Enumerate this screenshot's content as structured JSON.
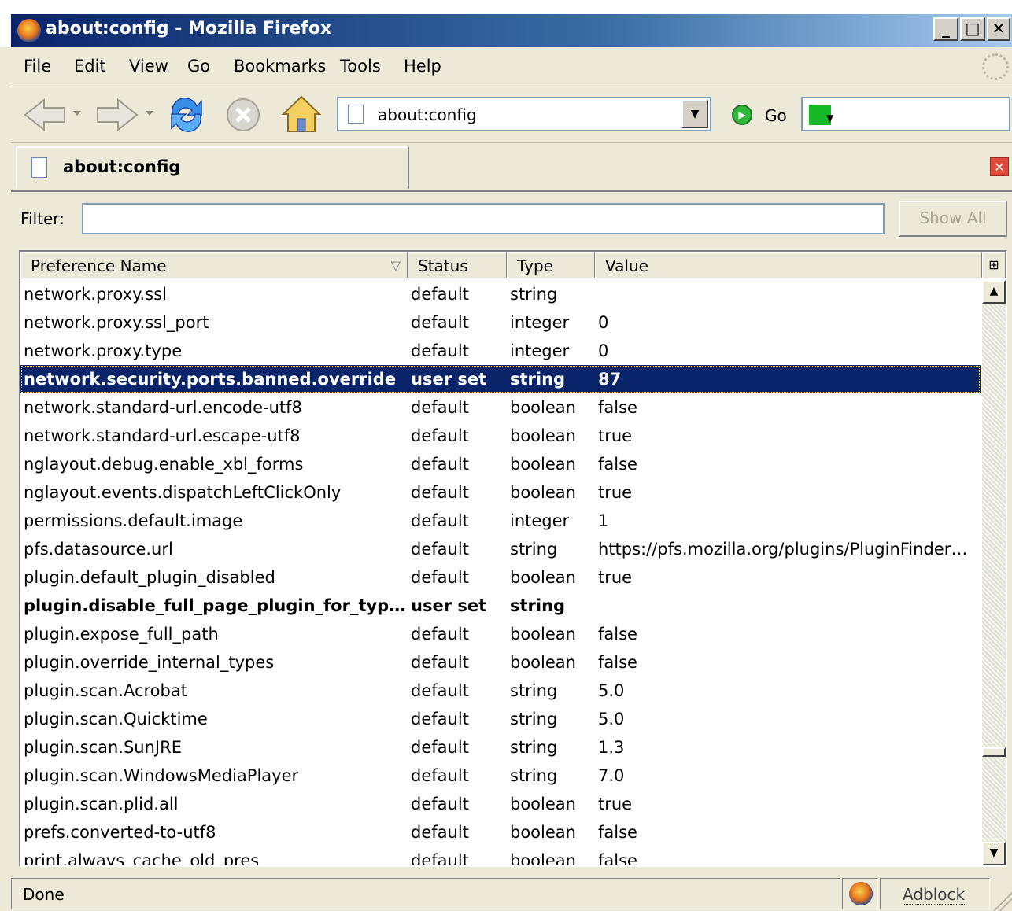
{
  "window": {
    "title": "about:config - Mozilla Firefox",
    "caption_buttons": {
      "minimize": "_",
      "maximize": "□",
      "close": "✕"
    }
  },
  "menu": [
    "File",
    "Edit",
    "View",
    "Go",
    "Bookmarks",
    "Tools",
    "Help"
  ],
  "navigation": {
    "url": "about:config",
    "go_label": "Go",
    "icons": [
      "back-icon",
      "forward-icon",
      "reload-icon",
      "stop-icon",
      "home-icon"
    ]
  },
  "tab": {
    "label": "about:config"
  },
  "filter": {
    "label": "Filter:",
    "value": "",
    "show_all_label": "Show All"
  },
  "columns": {
    "name": "Preference Name",
    "status": "Status",
    "type": "Type",
    "value": "Value"
  },
  "rows": [
    {
      "name": "network.proxy.ssl",
      "status": "default",
      "type": "string",
      "value": ""
    },
    {
      "name": "network.proxy.ssl_port",
      "status": "default",
      "type": "integer",
      "value": "0"
    },
    {
      "name": "network.proxy.type",
      "status": "default",
      "type": "integer",
      "value": "0"
    },
    {
      "name": "network.security.ports.banned.override",
      "status": "user set",
      "type": "string",
      "value": "87",
      "selected": true
    },
    {
      "name": "network.standard-url.encode-utf8",
      "status": "default",
      "type": "boolean",
      "value": "false"
    },
    {
      "name": "network.standard-url.escape-utf8",
      "status": "default",
      "type": "boolean",
      "value": "true"
    },
    {
      "name": "nglayout.debug.enable_xbl_forms",
      "status": "default",
      "type": "boolean",
      "value": "false"
    },
    {
      "name": "nglayout.events.dispatchLeftClickOnly",
      "status": "default",
      "type": "boolean",
      "value": "true"
    },
    {
      "name": "permissions.default.image",
      "status": "default",
      "type": "integer",
      "value": "1"
    },
    {
      "name": "pfs.datasource.url",
      "status": "default",
      "type": "string",
      "value": "https://pfs.mozilla.org/plugins/PluginFinderSer..."
    },
    {
      "name": "plugin.default_plugin_disabled",
      "status": "default",
      "type": "boolean",
      "value": "true"
    },
    {
      "name": "plugin.disable_full_page_plugin_for_types",
      "status": "user set",
      "type": "string",
      "value": ""
    },
    {
      "name": "plugin.expose_full_path",
      "status": "default",
      "type": "boolean",
      "value": "false"
    },
    {
      "name": "plugin.override_internal_types",
      "status": "default",
      "type": "boolean",
      "value": "false"
    },
    {
      "name": "plugin.scan.Acrobat",
      "status": "default",
      "type": "string",
      "value": "5.0"
    },
    {
      "name": "plugin.scan.Quicktime",
      "status": "default",
      "type": "string",
      "value": "5.0"
    },
    {
      "name": "plugin.scan.SunJRE",
      "status": "default",
      "type": "string",
      "value": "1.3"
    },
    {
      "name": "plugin.scan.WindowsMediaPlayer",
      "status": "default",
      "type": "string",
      "value": "7.0"
    },
    {
      "name": "plugin.scan.plid.all",
      "status": "default",
      "type": "boolean",
      "value": "true"
    },
    {
      "name": "prefs.converted-to-utf8",
      "status": "default",
      "type": "boolean",
      "value": "false"
    },
    {
      "name": "print.always_cache_old_pres",
      "status": "default",
      "type": "boolean",
      "value": "false"
    }
  ],
  "status_bar": {
    "text": "Done",
    "adblock_label": "Adblock"
  }
}
